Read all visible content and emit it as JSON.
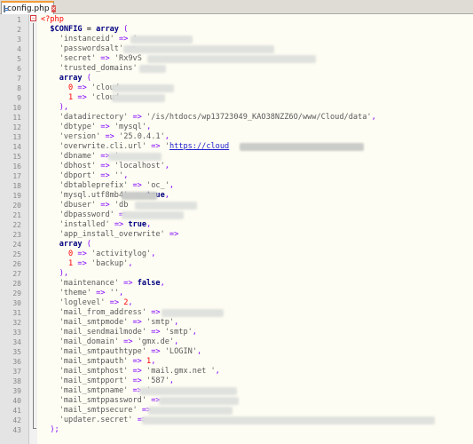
{
  "tab": {
    "filename": "config.php",
    "file_icon": "file-icon",
    "close_icon": "close-icon"
  },
  "lines": [
    "<?php",
    "  $CONFIG = array (",
    "    'instanceid' => '",
    "    'passwordsalt' =>",
    "    'secret' => 'Rx9vS",
    "    'trusted_domains' =>",
    "    array (",
    "      0 => 'cloud",
    "      1 => 'cloud",
    "    ),",
    "    'datadirectory' => '/is/htdocs/wp13723049_KAO38NZZ6O/www/Cloud/data',",
    "    'dbtype' => 'mysql',",
    "    'version' => '25.0.4.1',",
    "    'overwrite.cli.url' => 'https://cloud",
    "    'dbname' => '",
    "    'dbhost' => 'localhost',",
    "    'dbport' => '',",
    "    'dbtableprefix' => 'oc_',",
    "    'mysql.utf8mb4' => true,",
    "    'dbuser' => 'db",
    "    'dbpassword' =>",
    "    'installed' => true,",
    "    'app_install_overwrite' =>",
    "    array (",
    "      0 => 'activitylog',",
    "      1 => 'backup',",
    "    ),",
    "    'maintenance' => false,",
    "    'theme' => '',",
    "    'loglevel' => 2,",
    "    'mail_from_address' =>",
    "    'mail_smtpmode' => 'smtp',",
    "    'mail_sendmailmode' => 'smtp',",
    "    'mail_domain' => 'gmx.de',",
    "    'mail_smtpauthtype' => 'LOGIN',",
    "    'mail_smtpauth' => 1,",
    "    'mail_smtphost' => 'mail.gmx.net ',",
    "    'mail_smtpport' => '587',",
    "    'mail_smtpname' => '",
    "    'mail_smtppassword' =>",
    "    'mail_smtpsecure' =>",
    "    'updater.secret' =>",
    "  );"
  ],
  "colors": {
    "keyword": "#000080",
    "operator": "#8000ff",
    "string": "#5a5a5a",
    "number": "#ff0000",
    "php_tag": "#ff0000",
    "tab_accent": "#f29b38"
  }
}
